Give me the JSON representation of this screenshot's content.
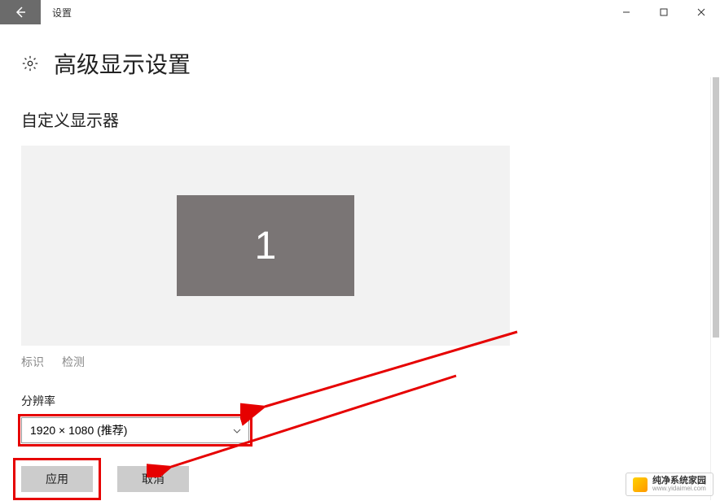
{
  "titlebar": {
    "title": "设置"
  },
  "page": {
    "heading": "高级显示设置",
    "section_heading": "自定义显示器"
  },
  "monitor": {
    "number": "1"
  },
  "links": {
    "identify": "标识",
    "detect": "检测"
  },
  "resolution": {
    "label": "分辨率",
    "selected": "1920 × 1080 (推荐)"
  },
  "buttons": {
    "apply": "应用",
    "cancel": "取消"
  },
  "watermark": {
    "name": "纯净系统家园",
    "url": "www.yidaimei.com"
  }
}
